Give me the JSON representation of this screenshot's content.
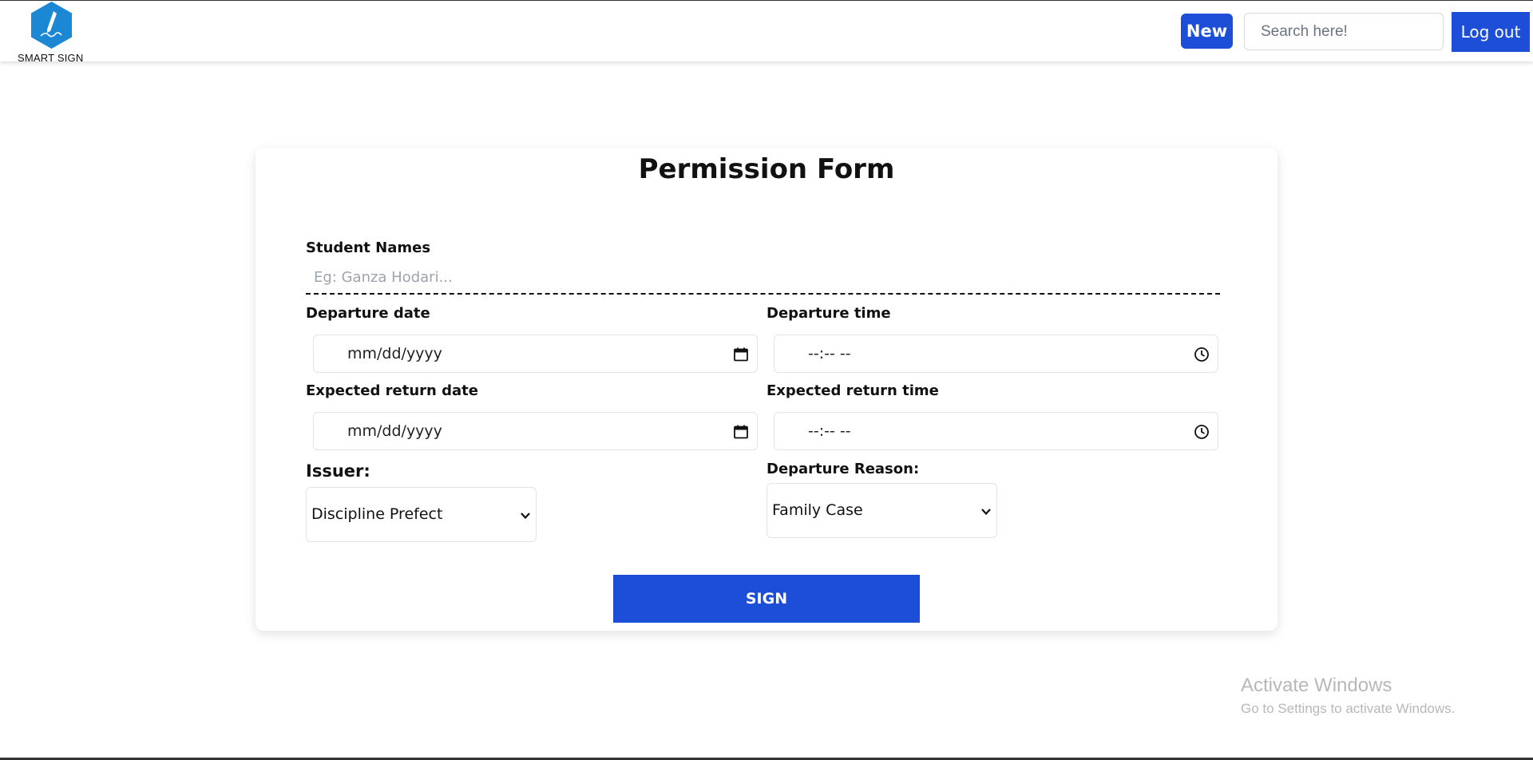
{
  "header": {
    "brand_name": "SMART SIGN",
    "new_label": "New",
    "search_placeholder": "Search here!",
    "logout_label": "Log out",
    "accent_color": "#1d4ed8"
  },
  "form": {
    "title": "Permission Form",
    "student_names_label": "Student Names",
    "student_names_placeholder": "Eg: Ganza Hodari...",
    "departure_date_label": "Departure date",
    "departure_date_value": "mm/dd/yyyy",
    "departure_time_label": "Departure time",
    "departure_time_value": "--:-- --",
    "return_date_label": "Expected return date",
    "return_date_value": "mm/dd/yyyy",
    "return_time_label": "Expected return time",
    "return_time_value": "--:-- --",
    "issuer_label": "Issuer:",
    "issuer_value": "Discipline Prefect",
    "reason_label": "Departure Reason:",
    "reason_value": "Family Case",
    "sign_label": "SIGN"
  },
  "watermark": {
    "title": "Activate Windows",
    "subtitle": "Go to Settings to activate Windows."
  },
  "icons": [
    "pen-logo-icon",
    "calendar-icon",
    "clock-icon",
    "chevron-down-icon"
  ]
}
